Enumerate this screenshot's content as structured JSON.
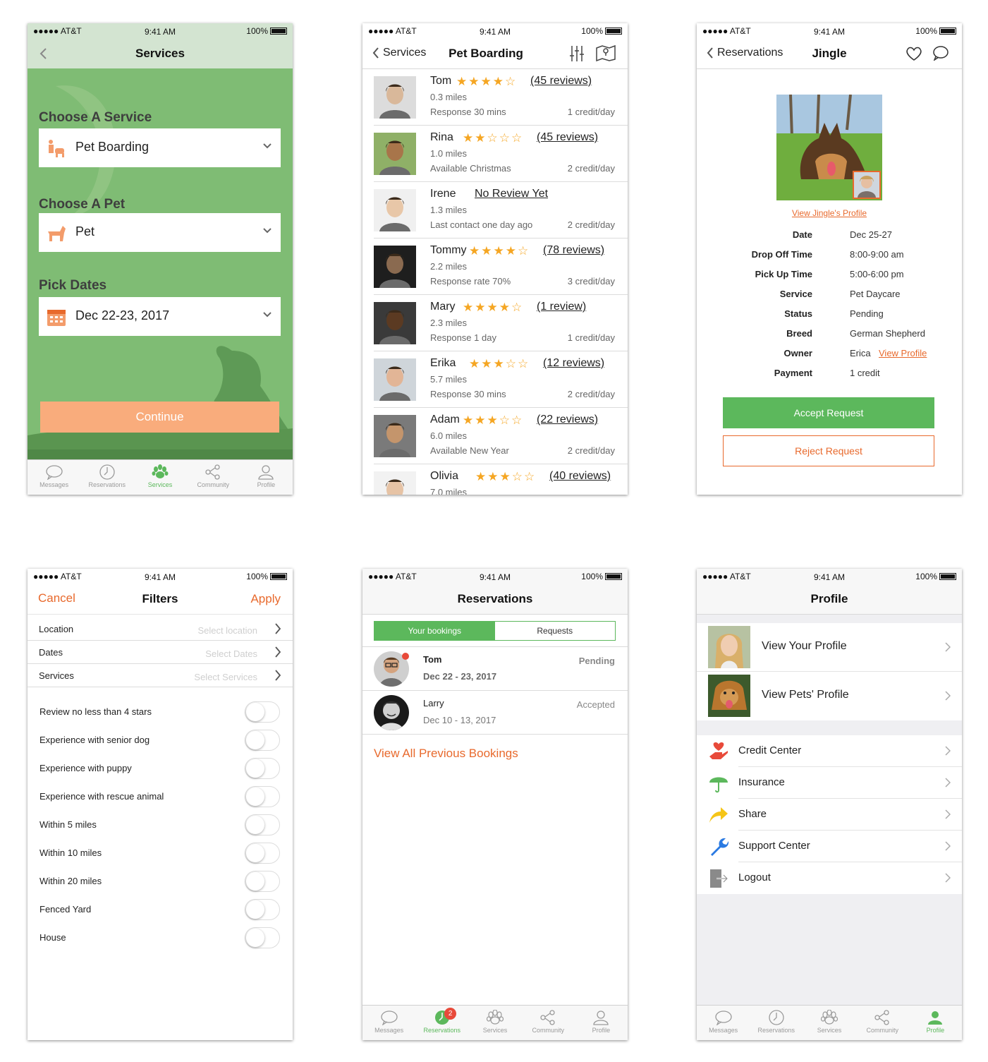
{
  "status": {
    "carrier": "●●●●● AT&T",
    "time": "9:41 AM",
    "battery": "100%"
  },
  "tabs": [
    "Messages",
    "Reservations",
    "Services",
    "Community",
    "Profile"
  ],
  "screen1": {
    "title": "Services",
    "service_label": "Choose A Service",
    "service_value": "Pet Boarding",
    "pet_label": "Choose A Pet",
    "pet_value": "Pet",
    "dates_label": "Pick Dates",
    "dates_value": "Dec 22-23, 2017",
    "continue": "Continue",
    "active_tab": "Services"
  },
  "screen2": {
    "back": "Services",
    "title": "Pet Boarding",
    "sitters": [
      {
        "name": "Tom",
        "rating": 4,
        "reviews": "(45 reviews)",
        "miles": "0.3 miles",
        "extra": "Response 30 mins",
        "credit": "1 credit/day"
      },
      {
        "name": "Rina",
        "rating": 2,
        "reviews": "(45 reviews)",
        "miles": "1.0 miles",
        "extra": "Available Christmas",
        "credit": "2 credit/day"
      },
      {
        "name": "Irene",
        "rating": 0,
        "reviews": "No Review Yet",
        "miles": "1.3 miles",
        "extra": "Last contact one day ago",
        "credit": "2 credit/day"
      },
      {
        "name": "Tommy",
        "rating": 4,
        "reviews": "(78 reviews)",
        "miles": "2.2 miles",
        "extra": "Response rate 70%",
        "credit": "3 credit/day"
      },
      {
        "name": "Mary",
        "rating": 4,
        "reviews": "(1 review)",
        "miles": "2.3 miles",
        "extra": "Response 1 day",
        "credit": "1 credit/day"
      },
      {
        "name": "Erika",
        "rating": 3,
        "reviews": "(12 reviews)",
        "miles": "5.7 miles",
        "extra": "Response 30 mins",
        "credit": "2 credit/day"
      },
      {
        "name": "Adam",
        "rating": 3,
        "reviews": "(22 reviews)",
        "miles": "6.0 miles",
        "extra": "Available New Year",
        "credit": "2 credit/day"
      },
      {
        "name": "Olivia",
        "rating": 3,
        "reviews": "(40 reviews)",
        "miles": "7.0 miles",
        "extra": "",
        "credit": ""
      }
    ]
  },
  "screen3": {
    "back": "Reservations",
    "title": "Jingle",
    "profile_link": "View Jingle's Profile",
    "details": [
      {
        "key": "Date",
        "value": "Dec 25-27"
      },
      {
        "key": "Drop Off Time",
        "value": "8:00-9:00 am"
      },
      {
        "key": "Pick Up Time",
        "value": "5:00-6:00 pm"
      },
      {
        "key": "Service",
        "value": "Pet Daycare"
      },
      {
        "key": "Status",
        "value": "Pending"
      },
      {
        "key": "Breed",
        "value": "German Shepherd"
      },
      {
        "key": "Owner",
        "value": "Erica"
      },
      {
        "key": "Payment",
        "value": "1 credit"
      }
    ],
    "owner_link": "View Profile",
    "accept": "Accept Request",
    "reject": "Reject Request"
  },
  "screen4": {
    "cancel": "Cancel",
    "title": "Filters",
    "apply": "Apply",
    "rows": [
      {
        "label": "Location",
        "placeholder": "Select location"
      },
      {
        "label": "Dates",
        "placeholder": "Select Dates"
      },
      {
        "label": "Services",
        "placeholder": "Select Services"
      }
    ],
    "toggles": [
      "Review no less than 4 stars",
      "Experience with senior dog",
      "Experience with puppy",
      "Experience with rescue animal",
      "Within 5 miles",
      "Within 10 miles",
      "Within 20 miles",
      "Fenced Yard",
      "House"
    ]
  },
  "screen5": {
    "title": "Reservations",
    "seg_on": "Your bookings",
    "seg_off": "Requests",
    "bookings": [
      {
        "name": "Tom",
        "dates": "Dec 22 - 23, 2017",
        "status": "Pending"
      },
      {
        "name": "Larry",
        "dates": "Dec 10 - 13, 2017",
        "status": "Accepted"
      }
    ],
    "previous": "View All Previous Bookings",
    "badge": "2",
    "active_tab": "Reservations"
  },
  "screen6": {
    "title": "Profile",
    "profile_rows": [
      "View Your Profile",
      "View Pets' Profile"
    ],
    "menu": [
      {
        "label": "Credit Center",
        "icon": "heart-hand-icon",
        "color": "#e84a3a"
      },
      {
        "label": "Insurance",
        "icon": "umbrella-icon",
        "color": "#5cb85c"
      },
      {
        "label": "Share",
        "icon": "share-arrow-icon",
        "color": "#f5c518"
      },
      {
        "label": "Support Center",
        "icon": "wrench-icon",
        "color": "#2a7ae2"
      },
      {
        "label": "Logout",
        "icon": "logout-icon",
        "color": "#8a8a8a"
      }
    ],
    "active_tab": "Profile"
  },
  "colors": {
    "green": "#5cb85c",
    "orange": "#e8692c",
    "peach": "#f9ac7c",
    "star": "#f5a623",
    "bg_green": "#7fbc74"
  }
}
